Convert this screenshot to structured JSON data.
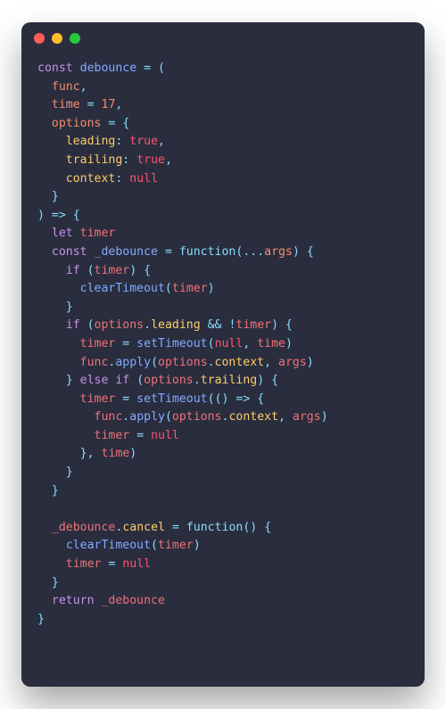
{
  "colors": {
    "bg": "#292d3e",
    "red": "#ff5f56",
    "yellow": "#ffbd2e",
    "green": "#27c93f",
    "t_keyword": "#c792ea",
    "t_def": "#82aaff",
    "t_param": "#f78c6c",
    "t_punct": "#89ddff",
    "t_default": "#a6accd",
    "t_number": "#f78c6c",
    "t_prop": "#ffcb6b",
    "t_bool": "#ff5370",
    "t_func": "#82aaff",
    "t_null": "#ff5370",
    "t_fnkw": "#89ddff",
    "t_ident": "#f07178"
  },
  "tokens": [
    [
      [
        "const ",
        "keyword"
      ],
      [
        "debounce",
        "def"
      ],
      [
        " ",
        "d"
      ],
      [
        "=",
        "punct"
      ],
      [
        " ",
        "d"
      ],
      [
        "(",
        "punct"
      ]
    ],
    [
      [
        "  ",
        "d"
      ],
      [
        "func",
        "param"
      ],
      [
        ",",
        "punct"
      ]
    ],
    [
      [
        "  ",
        "d"
      ],
      [
        "time",
        "param"
      ],
      [
        " ",
        "d"
      ],
      [
        "=",
        "punct"
      ],
      [
        " ",
        "d"
      ],
      [
        "17",
        "number"
      ],
      [
        ",",
        "punct"
      ]
    ],
    [
      [
        "  ",
        "d"
      ],
      [
        "options",
        "param"
      ],
      [
        " ",
        "d"
      ],
      [
        "=",
        "punct"
      ],
      [
        " ",
        "d"
      ],
      [
        "{",
        "punct"
      ]
    ],
    [
      [
        "    ",
        "d"
      ],
      [
        "leading",
        "prop"
      ],
      [
        ":",
        "punct"
      ],
      [
        " ",
        "d"
      ],
      [
        "true",
        "bool"
      ],
      [
        ",",
        "punct"
      ]
    ],
    [
      [
        "    ",
        "d"
      ],
      [
        "trailing",
        "prop"
      ],
      [
        ":",
        "punct"
      ],
      [
        " ",
        "d"
      ],
      [
        "true",
        "bool"
      ],
      [
        ",",
        "punct"
      ]
    ],
    [
      [
        "    ",
        "d"
      ],
      [
        "context",
        "prop"
      ],
      [
        ":",
        "punct"
      ],
      [
        " ",
        "d"
      ],
      [
        "null",
        "null"
      ]
    ],
    [
      [
        "  ",
        "d"
      ],
      [
        "}",
        "punct"
      ]
    ],
    [
      [
        ")",
        "punct"
      ],
      [
        " ",
        "d"
      ],
      [
        "=>",
        "punct"
      ],
      [
        " ",
        "d"
      ],
      [
        "{",
        "punct"
      ]
    ],
    [
      [
        "  ",
        "d"
      ],
      [
        "let ",
        "keyword"
      ],
      [
        "timer",
        "ident"
      ]
    ],
    [
      [
        "  ",
        "d"
      ],
      [
        "const ",
        "keyword"
      ],
      [
        "_debounce",
        "def"
      ],
      [
        " ",
        "d"
      ],
      [
        "=",
        "punct"
      ],
      [
        " ",
        "d"
      ],
      [
        "function",
        "fnkw"
      ],
      [
        "(",
        "punct"
      ],
      [
        "...",
        "punct"
      ],
      [
        "args",
        "param"
      ],
      [
        ")",
        "punct"
      ],
      [
        " ",
        "d"
      ],
      [
        "{",
        "punct"
      ]
    ],
    [
      [
        "    ",
        "d"
      ],
      [
        "if ",
        "keyword"
      ],
      [
        "(",
        "punct"
      ],
      [
        "timer",
        "ident"
      ],
      [
        ")",
        "punct"
      ],
      [
        " ",
        "d"
      ],
      [
        "{",
        "punct"
      ]
    ],
    [
      [
        "      ",
        "d"
      ],
      [
        "clearTimeout",
        "func"
      ],
      [
        "(",
        "punct"
      ],
      [
        "timer",
        "ident"
      ],
      [
        ")",
        "punct"
      ]
    ],
    [
      [
        "    ",
        "d"
      ],
      [
        "}",
        "punct"
      ]
    ],
    [
      [
        "    ",
        "d"
      ],
      [
        "if ",
        "keyword"
      ],
      [
        "(",
        "punct"
      ],
      [
        "options",
        "ident"
      ],
      [
        ".",
        "punct"
      ],
      [
        "leading",
        "prop"
      ],
      [
        " ",
        "d"
      ],
      [
        "&&",
        "punct"
      ],
      [
        " ",
        "d"
      ],
      [
        "!",
        "punct"
      ],
      [
        "timer",
        "ident"
      ],
      [
        ")",
        "punct"
      ],
      [
        " ",
        "d"
      ],
      [
        "{",
        "punct"
      ]
    ],
    [
      [
        "      ",
        "d"
      ],
      [
        "timer",
        "ident"
      ],
      [
        " ",
        "d"
      ],
      [
        "=",
        "punct"
      ],
      [
        " ",
        "d"
      ],
      [
        "setTimeout",
        "func"
      ],
      [
        "(",
        "punct"
      ],
      [
        "null",
        "null"
      ],
      [
        ",",
        "punct"
      ],
      [
        " ",
        "d"
      ],
      [
        "time",
        "ident"
      ],
      [
        ")",
        "punct"
      ]
    ],
    [
      [
        "      ",
        "d"
      ],
      [
        "func",
        "ident"
      ],
      [
        ".",
        "punct"
      ],
      [
        "apply",
        "func"
      ],
      [
        "(",
        "punct"
      ],
      [
        "options",
        "ident"
      ],
      [
        ".",
        "punct"
      ],
      [
        "context",
        "prop"
      ],
      [
        ",",
        "punct"
      ],
      [
        " ",
        "d"
      ],
      [
        "args",
        "ident"
      ],
      [
        ")",
        "punct"
      ]
    ],
    [
      [
        "    ",
        "d"
      ],
      [
        "}",
        "punct"
      ],
      [
        " ",
        "d"
      ],
      [
        "else if ",
        "keyword"
      ],
      [
        "(",
        "punct"
      ],
      [
        "options",
        "ident"
      ],
      [
        ".",
        "punct"
      ],
      [
        "trailing",
        "prop"
      ],
      [
        ")",
        "punct"
      ],
      [
        " ",
        "d"
      ],
      [
        "{",
        "punct"
      ]
    ],
    [
      [
        "      ",
        "d"
      ],
      [
        "timer",
        "ident"
      ],
      [
        " ",
        "d"
      ],
      [
        "=",
        "punct"
      ],
      [
        " ",
        "d"
      ],
      [
        "setTimeout",
        "func"
      ],
      [
        "(",
        "punct"
      ],
      [
        "(",
        "punct"
      ],
      [
        ")",
        "punct"
      ],
      [
        " ",
        "d"
      ],
      [
        "=>",
        "punct"
      ],
      [
        " ",
        "d"
      ],
      [
        "{",
        "punct"
      ]
    ],
    [
      [
        "        ",
        "d"
      ],
      [
        "func",
        "ident"
      ],
      [
        ".",
        "punct"
      ],
      [
        "apply",
        "func"
      ],
      [
        "(",
        "punct"
      ],
      [
        "options",
        "ident"
      ],
      [
        ".",
        "punct"
      ],
      [
        "context",
        "prop"
      ],
      [
        ",",
        "punct"
      ],
      [
        " ",
        "d"
      ],
      [
        "args",
        "ident"
      ],
      [
        ")",
        "punct"
      ]
    ],
    [
      [
        "        ",
        "d"
      ],
      [
        "timer",
        "ident"
      ],
      [
        " ",
        "d"
      ],
      [
        "=",
        "punct"
      ],
      [
        " ",
        "d"
      ],
      [
        "null",
        "null"
      ]
    ],
    [
      [
        "      ",
        "d"
      ],
      [
        "}",
        "punct"
      ],
      [
        ",",
        "punct"
      ],
      [
        " ",
        "d"
      ],
      [
        "time",
        "ident"
      ],
      [
        ")",
        "punct"
      ]
    ],
    [
      [
        "    ",
        "d"
      ],
      [
        "}",
        "punct"
      ]
    ],
    [
      [
        "  ",
        "d"
      ],
      [
        "}",
        "punct"
      ]
    ],
    [
      [
        "",
        "d"
      ]
    ],
    [
      [
        "  ",
        "d"
      ],
      [
        "_debounce",
        "ident"
      ],
      [
        ".",
        "punct"
      ],
      [
        "cancel",
        "prop"
      ],
      [
        " ",
        "d"
      ],
      [
        "=",
        "punct"
      ],
      [
        " ",
        "d"
      ],
      [
        "function",
        "fnkw"
      ],
      [
        "(",
        "punct"
      ],
      [
        ")",
        "punct"
      ],
      [
        " ",
        "d"
      ],
      [
        "{",
        "punct"
      ]
    ],
    [
      [
        "    ",
        "d"
      ],
      [
        "clearTimeout",
        "func"
      ],
      [
        "(",
        "punct"
      ],
      [
        "timer",
        "ident"
      ],
      [
        ")",
        "punct"
      ]
    ],
    [
      [
        "    ",
        "d"
      ],
      [
        "timer",
        "ident"
      ],
      [
        " ",
        "d"
      ],
      [
        "=",
        "punct"
      ],
      [
        " ",
        "d"
      ],
      [
        "null",
        "null"
      ]
    ],
    [
      [
        "  ",
        "d"
      ],
      [
        "}",
        "punct"
      ]
    ],
    [
      [
        "  ",
        "d"
      ],
      [
        "return ",
        "keyword"
      ],
      [
        "_debounce",
        "ident"
      ]
    ],
    [
      [
        "}",
        "punct"
      ]
    ]
  ]
}
